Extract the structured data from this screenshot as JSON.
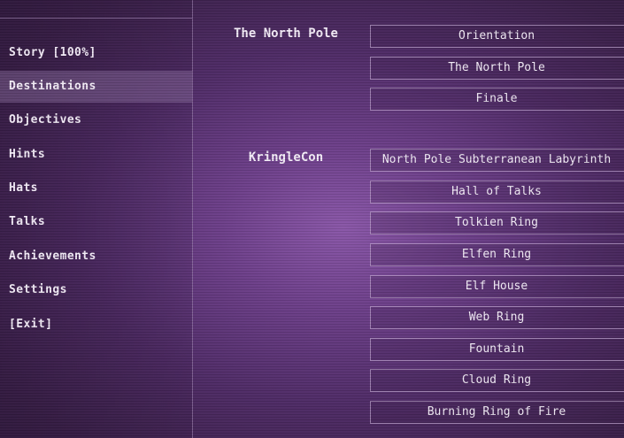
{
  "menu": {
    "items": [
      {
        "label": "Story [100%]"
      },
      {
        "label": "Destinations"
      },
      {
        "label": "Objectives"
      },
      {
        "label": "Hints"
      },
      {
        "label": "Hats"
      },
      {
        "label": "Talks"
      },
      {
        "label": "Achievements"
      },
      {
        "label": "Settings"
      },
      {
        "label": "[Exit]"
      }
    ],
    "active": "Destinations"
  },
  "destinations": {
    "groups": [
      {
        "name": "The North Pole",
        "places": [
          "Orientation",
          "The North Pole",
          "Finale"
        ]
      },
      {
        "name": "KringleCon",
        "places": [
          "North Pole Subterranean Labyrinth",
          "Hall of Talks",
          "Tolkien Ring",
          "Elfen Ring",
          "Elf House",
          "Web Ring",
          "Fountain",
          "Cloud Ring",
          "Burning Ring of Fire"
        ]
      }
    ]
  },
  "colors": {
    "background": "#5a3173",
    "text": "#f3ecf7",
    "border": "#c8aadc",
    "active_item": "#8c6ea0"
  }
}
